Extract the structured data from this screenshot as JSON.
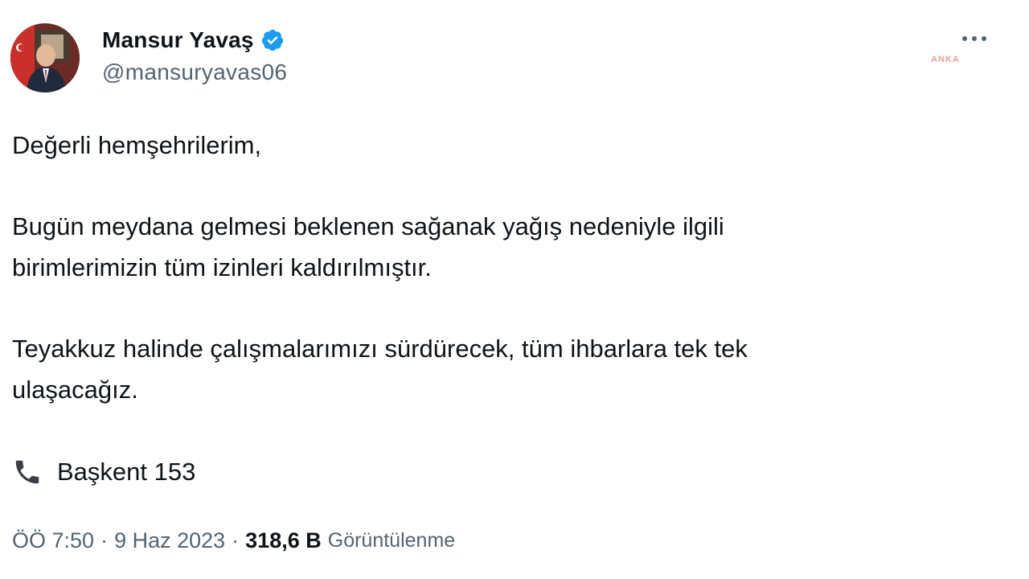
{
  "user": {
    "display_name": "Mansur Yavaş",
    "handle": "@mansuryavas06",
    "verified_icon": "verified-badge-icon",
    "avatar": "avatar-photo"
  },
  "menu": {
    "more_icon": "more-options-icon"
  },
  "watermark": "ANKA",
  "tweet": {
    "lines": [
      "Değerli hemşehrilerim,",
      "Bugün meydana gelmesi beklenen sağanak yağış nedeniyle ilgili",
      "birimlerimizin tüm izinleri kaldırılmıştır.",
      "Teyakkuz halinde çalışmalarımızı sürdürecek, tüm ihbarlara tek tek",
      "ulaşacağız."
    ],
    "phone_icon": "telephone-receiver-icon",
    "phone_text": "Başkent 153"
  },
  "meta": {
    "time": "ÖÖ 7:50",
    "separator": "·",
    "date": "9 Haz 2023",
    "views_count": "318,6 B",
    "views_label": "Görüntülenme"
  },
  "colors": {
    "text": "#0f1419",
    "secondary": "#536471",
    "verified": "#1d9bf0"
  }
}
